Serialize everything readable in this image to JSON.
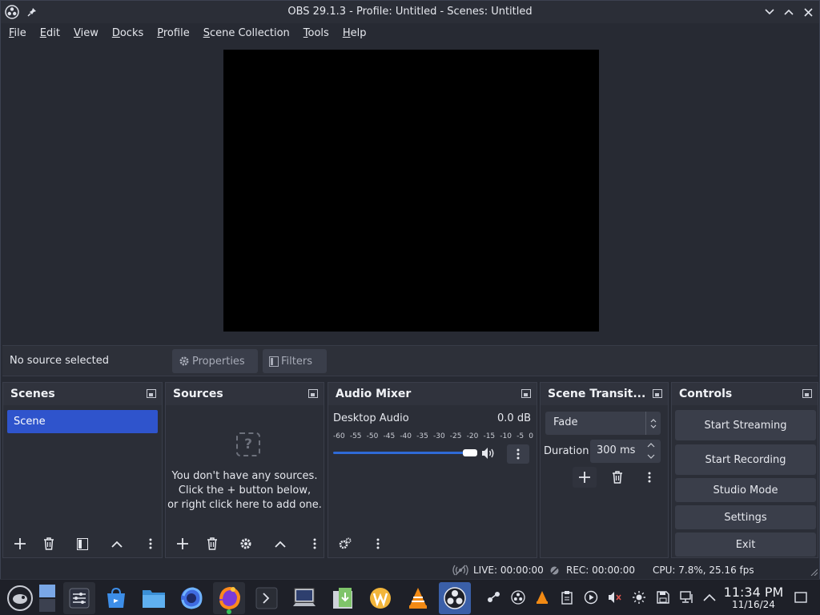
{
  "window": {
    "title": "OBS 29.1.3 - Profile: Untitled - Scenes: Untitled"
  },
  "menu": [
    "File",
    "Edit",
    "View",
    "Docks",
    "Profile",
    "Scene Collection",
    "Tools",
    "Help"
  ],
  "source_bar": {
    "status": "No source selected",
    "properties_label": "Properties",
    "filters_label": "Filters"
  },
  "scenes": {
    "title": "Scenes",
    "items": [
      "Scene"
    ]
  },
  "sources": {
    "title": "Sources",
    "empty_line1": "You don't have any sources.",
    "empty_line2": "Click the + button below,",
    "empty_line3": "or right click here to add one."
  },
  "audio_mixer": {
    "title": "Audio Mixer",
    "channel_name": "Desktop Audio",
    "channel_db": "0.0 dB",
    "ticks": [
      "-60",
      "-55",
      "-50",
      "-45",
      "-40",
      "-35",
      "-30",
      "-25",
      "-20",
      "-15",
      "-10",
      "-5",
      "0"
    ],
    "volume_fraction": 1.0
  },
  "transitions": {
    "title": "Scene Transit...",
    "selected": "Fade",
    "duration_label": "Duration",
    "duration_value": "300 ms"
  },
  "controls": {
    "title": "Controls",
    "start_streaming": "Start Streaming",
    "start_recording": "Start Recording",
    "studio_mode": "Studio Mode",
    "settings": "Settings",
    "exit": "Exit"
  },
  "status": {
    "live": "LIVE: 00:00:00",
    "rec": "REC: 00:00:00",
    "cpu": "CPU: 7.8%, 25.16 fps"
  },
  "taskbar": {
    "time": "11:34 PM",
    "date": "11/16/24"
  },
  "colors": {
    "accent": "#2f54cc",
    "slider": "#2f6ad6",
    "background": "#272a33"
  }
}
